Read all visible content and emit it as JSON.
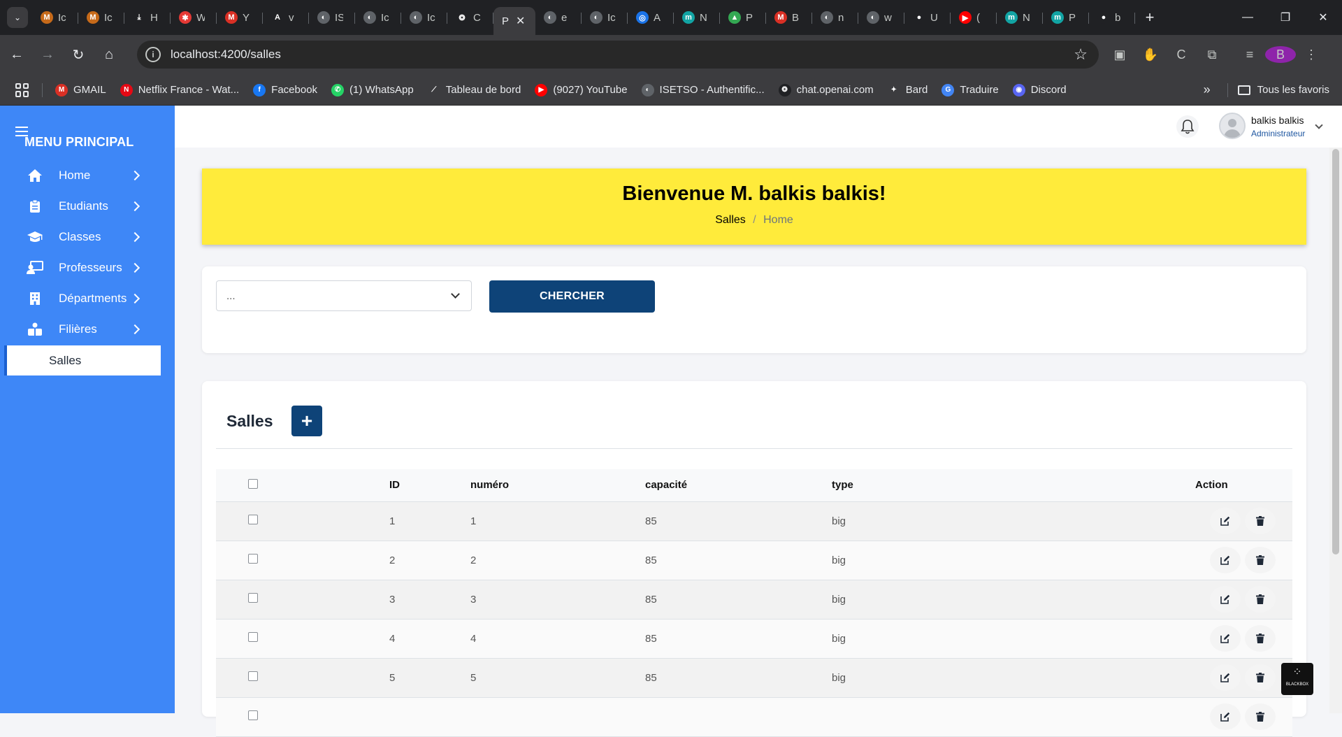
{
  "browser": {
    "tabs": [
      {
        "label": "Ic",
        "icon": "ic-favicon",
        "color": "#c66a1a",
        "glyph": "M"
      },
      {
        "label": "Ic",
        "icon": "ic-favicon",
        "color": "#c66a1a",
        "glyph": "M"
      },
      {
        "label": "H",
        "icon": "download-icon",
        "color": "#202124",
        "glyph": "⤓"
      },
      {
        "label": "W",
        "icon": "w-favicon",
        "color": "#e53935",
        "glyph": "✱"
      },
      {
        "label": "Y",
        "icon": "gmail-favicon",
        "color": "#d93025",
        "glyph": "M"
      },
      {
        "label": "v",
        "icon": "a-favicon",
        "color": "#202124",
        "glyph": "A"
      },
      {
        "label": "IS",
        "icon": "globe-favicon",
        "color": "#5f6368",
        "glyph": "◐"
      },
      {
        "label": "Ic",
        "icon": "globe-favicon",
        "color": "#5f6368",
        "glyph": "◐"
      },
      {
        "label": "Ic",
        "icon": "globe-favicon",
        "color": "#5f6368",
        "glyph": "◐"
      },
      {
        "label": "C",
        "icon": "openai-favicon",
        "color": "#202124",
        "glyph": "❂"
      },
      {
        "label": "P",
        "icon": "active-tab",
        "color": "#3c3c3f",
        "glyph": "",
        "active": true
      },
      {
        "label": "e",
        "icon": "globe-favicon",
        "color": "#5f6368",
        "glyph": "◐"
      },
      {
        "label": "Ic",
        "icon": "globe-favicon",
        "color": "#5f6368",
        "glyph": "◐"
      },
      {
        "label": "A",
        "icon": "a-favicon",
        "color": "#1a73e8",
        "glyph": "◎"
      },
      {
        "label": "N",
        "icon": "m-favicon",
        "color": "#12a4a4",
        "glyph": "m"
      },
      {
        "label": "P",
        "icon": "drive-favicon",
        "color": "#34a853",
        "glyph": "▲"
      },
      {
        "label": "B",
        "icon": "gmail-favicon",
        "color": "#d93025",
        "glyph": "M"
      },
      {
        "label": "n",
        "icon": "globe-favicon",
        "color": "#5f6368",
        "glyph": "◐"
      },
      {
        "label": "w",
        "icon": "globe-favicon",
        "color": "#5f6368",
        "glyph": "◐"
      },
      {
        "label": "U",
        "icon": "github-favicon",
        "color": "#202124",
        "glyph": "●"
      },
      {
        "label": "(",
        "icon": "youtube-favicon",
        "color": "#ff0000",
        "glyph": "▶"
      },
      {
        "label": "N",
        "icon": "m-favicon",
        "color": "#12a4a4",
        "glyph": "m"
      },
      {
        "label": "P",
        "icon": "m-favicon",
        "color": "#12a4a4",
        "glyph": "m"
      },
      {
        "label": "b",
        "icon": "github-favicon",
        "color": "#202124",
        "glyph": "●"
      }
    ],
    "url": "localhost:4200/salles",
    "profile_initial": "B",
    "bookmarks": [
      {
        "label": "GMAIL",
        "icon": "gmail-icon",
        "color": "#d93025",
        "glyph": "M"
      },
      {
        "label": "Netflix France - Wat...",
        "icon": "netflix-icon",
        "color": "#e50914",
        "glyph": "N"
      },
      {
        "label": "Facebook",
        "icon": "facebook-icon",
        "color": "#1877f2",
        "glyph": "f"
      },
      {
        "label": "(1) WhatsApp",
        "icon": "whatsapp-icon",
        "color": "#25d366",
        "glyph": "✆"
      },
      {
        "label": "Tableau de bord",
        "icon": "dashboard-icon",
        "color": "#3c3c3f",
        "glyph": "⟋"
      },
      {
        "label": "(9027) YouTube",
        "icon": "youtube-icon",
        "color": "#ff0000",
        "glyph": "▶"
      },
      {
        "label": "ISETSO - Authentific...",
        "icon": "globe-icon",
        "color": "#5f6368",
        "glyph": "◐"
      },
      {
        "label": "chat.openai.com",
        "icon": "openai-icon",
        "color": "#202124",
        "glyph": "❂"
      },
      {
        "label": "Bard",
        "icon": "bard-icon",
        "color": "#3c3c3f",
        "glyph": "✦"
      },
      {
        "label": "Traduire",
        "icon": "translate-icon",
        "color": "#4285f4",
        "glyph": "G"
      },
      {
        "label": "Discord",
        "icon": "discord-icon",
        "color": "#5865f2",
        "glyph": "◉"
      }
    ],
    "all_bookmarks_label": "Tous les favoris"
  },
  "sidebar": {
    "title": "MENU PRINCIPAL",
    "items": [
      {
        "label": "Home",
        "icon": "home-icon"
      },
      {
        "label": "Etudiants",
        "icon": "clipboard-icon"
      },
      {
        "label": "Classes",
        "icon": "graduation-cap-icon"
      },
      {
        "label": "Professeurs",
        "icon": "teacher-icon"
      },
      {
        "label": "Départments",
        "icon": "building-icon"
      },
      {
        "label": "Filières",
        "icon": "users-icon"
      }
    ],
    "active_sub": "Salles"
  },
  "header": {
    "user_name": "balkis balkis",
    "user_role": "Administrateur"
  },
  "banner": {
    "title": "Bienvenue M. balkis balkis!",
    "crumb_current": "Salles",
    "crumb_separator": "/",
    "crumb_home": "Home"
  },
  "search": {
    "select_value": "...",
    "button_label": "CHERCHER"
  },
  "table": {
    "title": "Salles",
    "add_label": "+",
    "headers": {
      "id": "ID",
      "numero": "numéro",
      "capacite": "capacité",
      "type": "type",
      "action": "Action"
    },
    "rows": [
      {
        "id": "1",
        "numero": "1",
        "capacite": "85",
        "type": "big"
      },
      {
        "id": "2",
        "numero": "2",
        "capacite": "85",
        "type": "big"
      },
      {
        "id": "3",
        "numero": "3",
        "capacite": "85",
        "type": "big"
      },
      {
        "id": "4",
        "numero": "4",
        "capacite": "85",
        "type": "big"
      },
      {
        "id": "5",
        "numero": "5",
        "capacite": "85",
        "type": "big"
      },
      {
        "id": "",
        "numero": "",
        "capacite": "",
        "type": ""
      }
    ]
  },
  "blackbox_label": "BLACKBOX"
}
